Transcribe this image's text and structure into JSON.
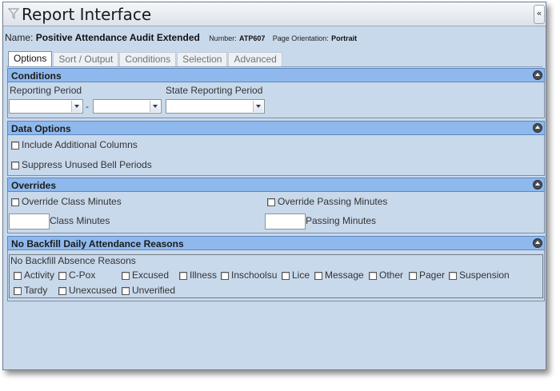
{
  "window": {
    "title": "Report Interface",
    "collapse_glyph": "«"
  },
  "report": {
    "name_label": "Name:",
    "name": "Positive Attendance Audit Extended",
    "number_label": "Number:",
    "number": "ATP607",
    "orientation_label": "Page Orientation:",
    "orientation": "Portrait"
  },
  "tabs": [
    {
      "label": "Options",
      "active": true
    },
    {
      "label": "Sort / Output",
      "active": false
    },
    {
      "label": "Conditions",
      "active": false
    },
    {
      "label": "Selection",
      "active": false
    },
    {
      "label": "Advanced",
      "active": false
    }
  ],
  "conditions": {
    "title": "Conditions",
    "reporting_period_label": "Reporting Period",
    "range_separator": "-",
    "state_reporting_period_label": "State Reporting Period",
    "reporting_period_start": "",
    "reporting_period_end": "",
    "state_reporting_period": ""
  },
  "data_options": {
    "title": "Data Options",
    "include_additional_columns": "Include Additional Columns",
    "suppress_unused_bell_periods": "Suppress Unused Bell Periods"
  },
  "overrides": {
    "title": "Overrides",
    "override_class_minutes": "Override Class Minutes",
    "override_passing_minutes": "Override Passing Minutes",
    "class_minutes_label": "Class Minutes",
    "passing_minutes_label": "Passing Minutes",
    "class_minutes_value": "",
    "passing_minutes_value": ""
  },
  "backfill": {
    "title": "No Backfill Daily Attendance Reasons",
    "group_label": "No Backfill Absence Reasons",
    "reasons": [
      "Activity",
      "C-Pox",
      "Excused",
      "Illness",
      "Inschoolsu",
      "Lice",
      "Message",
      "Other",
      "Pager",
      "Suspension",
      "Tardy",
      "Unexcused",
      "Unverified"
    ]
  },
  "icons": {
    "title": "filter-funnel-icon",
    "section_toggle": "collapse-circle-icon",
    "select_arrow": "chevron-down-icon"
  },
  "colors": {
    "panel_background": "#c9d9ec",
    "section_header": "#8fb9ec",
    "section_border": "#5a87c0"
  }
}
